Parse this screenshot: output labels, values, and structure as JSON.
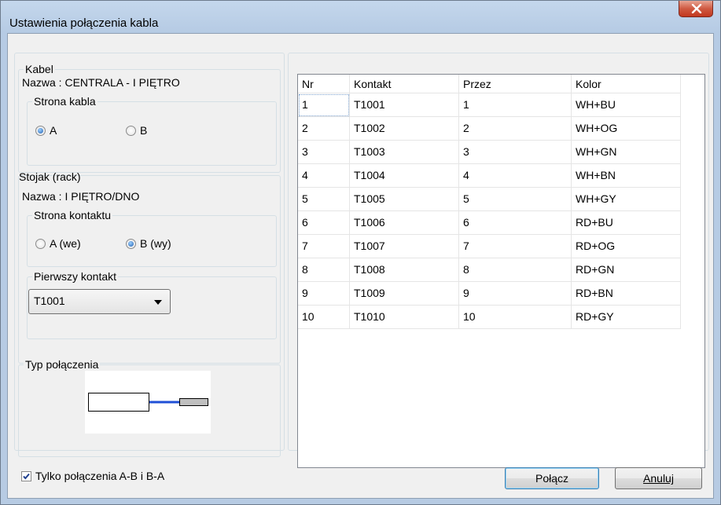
{
  "window": {
    "title": "Ustawienia połączenia kabla"
  },
  "cable": {
    "group_label": "Kabel",
    "name_line": "Nazwa : CENTRALA - I PIĘTRO",
    "side_group_label": "Strona kabla",
    "side_options": [
      "A",
      "B"
    ],
    "side_selected": "A"
  },
  "rack": {
    "group_label": "Stojak (rack)",
    "name_line": "Nazwa : I PIĘTRO/DNO",
    "contact_side_label": "Strona kontaktu",
    "contact_side_options": [
      "A (we)",
      "B (wy)"
    ],
    "contact_side_selected": "B (wy)",
    "first_contact_label": "Pierwszy kontakt",
    "first_contact_value": "T1001"
  },
  "connection_type": {
    "group_label": "Typ połączenia"
  },
  "table": {
    "columns": [
      "Nr",
      "Kontakt",
      "Przez",
      "Kolor"
    ],
    "rows": [
      [
        "1",
        "T1001",
        "1",
        "WH+BU"
      ],
      [
        "2",
        "T1002",
        "2",
        "WH+OG"
      ],
      [
        "3",
        "T1003",
        "3",
        "WH+GN"
      ],
      [
        "4",
        "T1004",
        "4",
        "WH+BN"
      ],
      [
        "5",
        "T1005",
        "5",
        "WH+GY"
      ],
      [
        "6",
        "T1006",
        "6",
        "RD+BU"
      ],
      [
        "7",
        "T1007",
        "7",
        "RD+OG"
      ],
      [
        "8",
        "T1008",
        "8",
        "RD+GN"
      ],
      [
        "9",
        "T1009",
        "9",
        "RD+BN"
      ],
      [
        "10",
        "T1010",
        "10",
        "RD+GY"
      ]
    ]
  },
  "footer": {
    "checkbox_label": "Tylko połączenia A-B i B-A",
    "checkbox_checked": true,
    "connect_button": "Połącz",
    "cancel_button": "Anuluj"
  },
  "icons": {
    "close": "close-icon",
    "combo_arrow": "chevron-down-icon",
    "checkbox_mark": "checkmark-icon"
  },
  "colors": {
    "close_button": "#c2381f",
    "radio_selected": "#1f5fb0",
    "cable_wire": "#1f4fd6",
    "cable_conductor": "#bfbfbf"
  }
}
